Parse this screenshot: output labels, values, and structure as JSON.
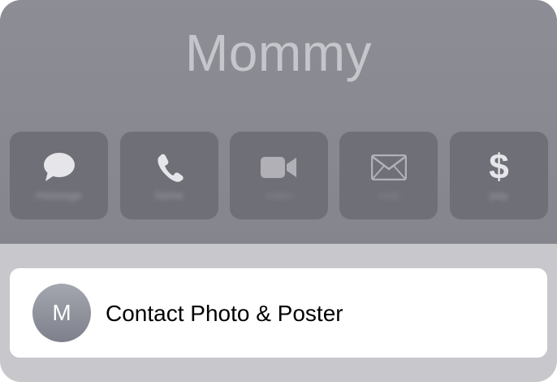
{
  "contact": {
    "name": "Mommy"
  },
  "actions": [
    {
      "label": "message",
      "icon": "message-bubble-icon"
    },
    {
      "label": "home",
      "icon": "phone-icon"
    },
    {
      "label": "video",
      "icon": "video-camera-icon"
    },
    {
      "label": "mail",
      "icon": "mail-envelope-icon"
    },
    {
      "label": "pay",
      "icon": "dollar-icon"
    }
  ],
  "dollar_symbol": "$",
  "card": {
    "avatar_initial": "M",
    "label": "Contact Photo & Poster"
  },
  "colors": {
    "header_bg": "#8a8a92",
    "action_bg": "#6f6f78",
    "icon": "#e6e6ea",
    "name_text": "#c9c9ce",
    "sheet_bg": "#c7c7cc",
    "card_bg": "#ffffff"
  }
}
